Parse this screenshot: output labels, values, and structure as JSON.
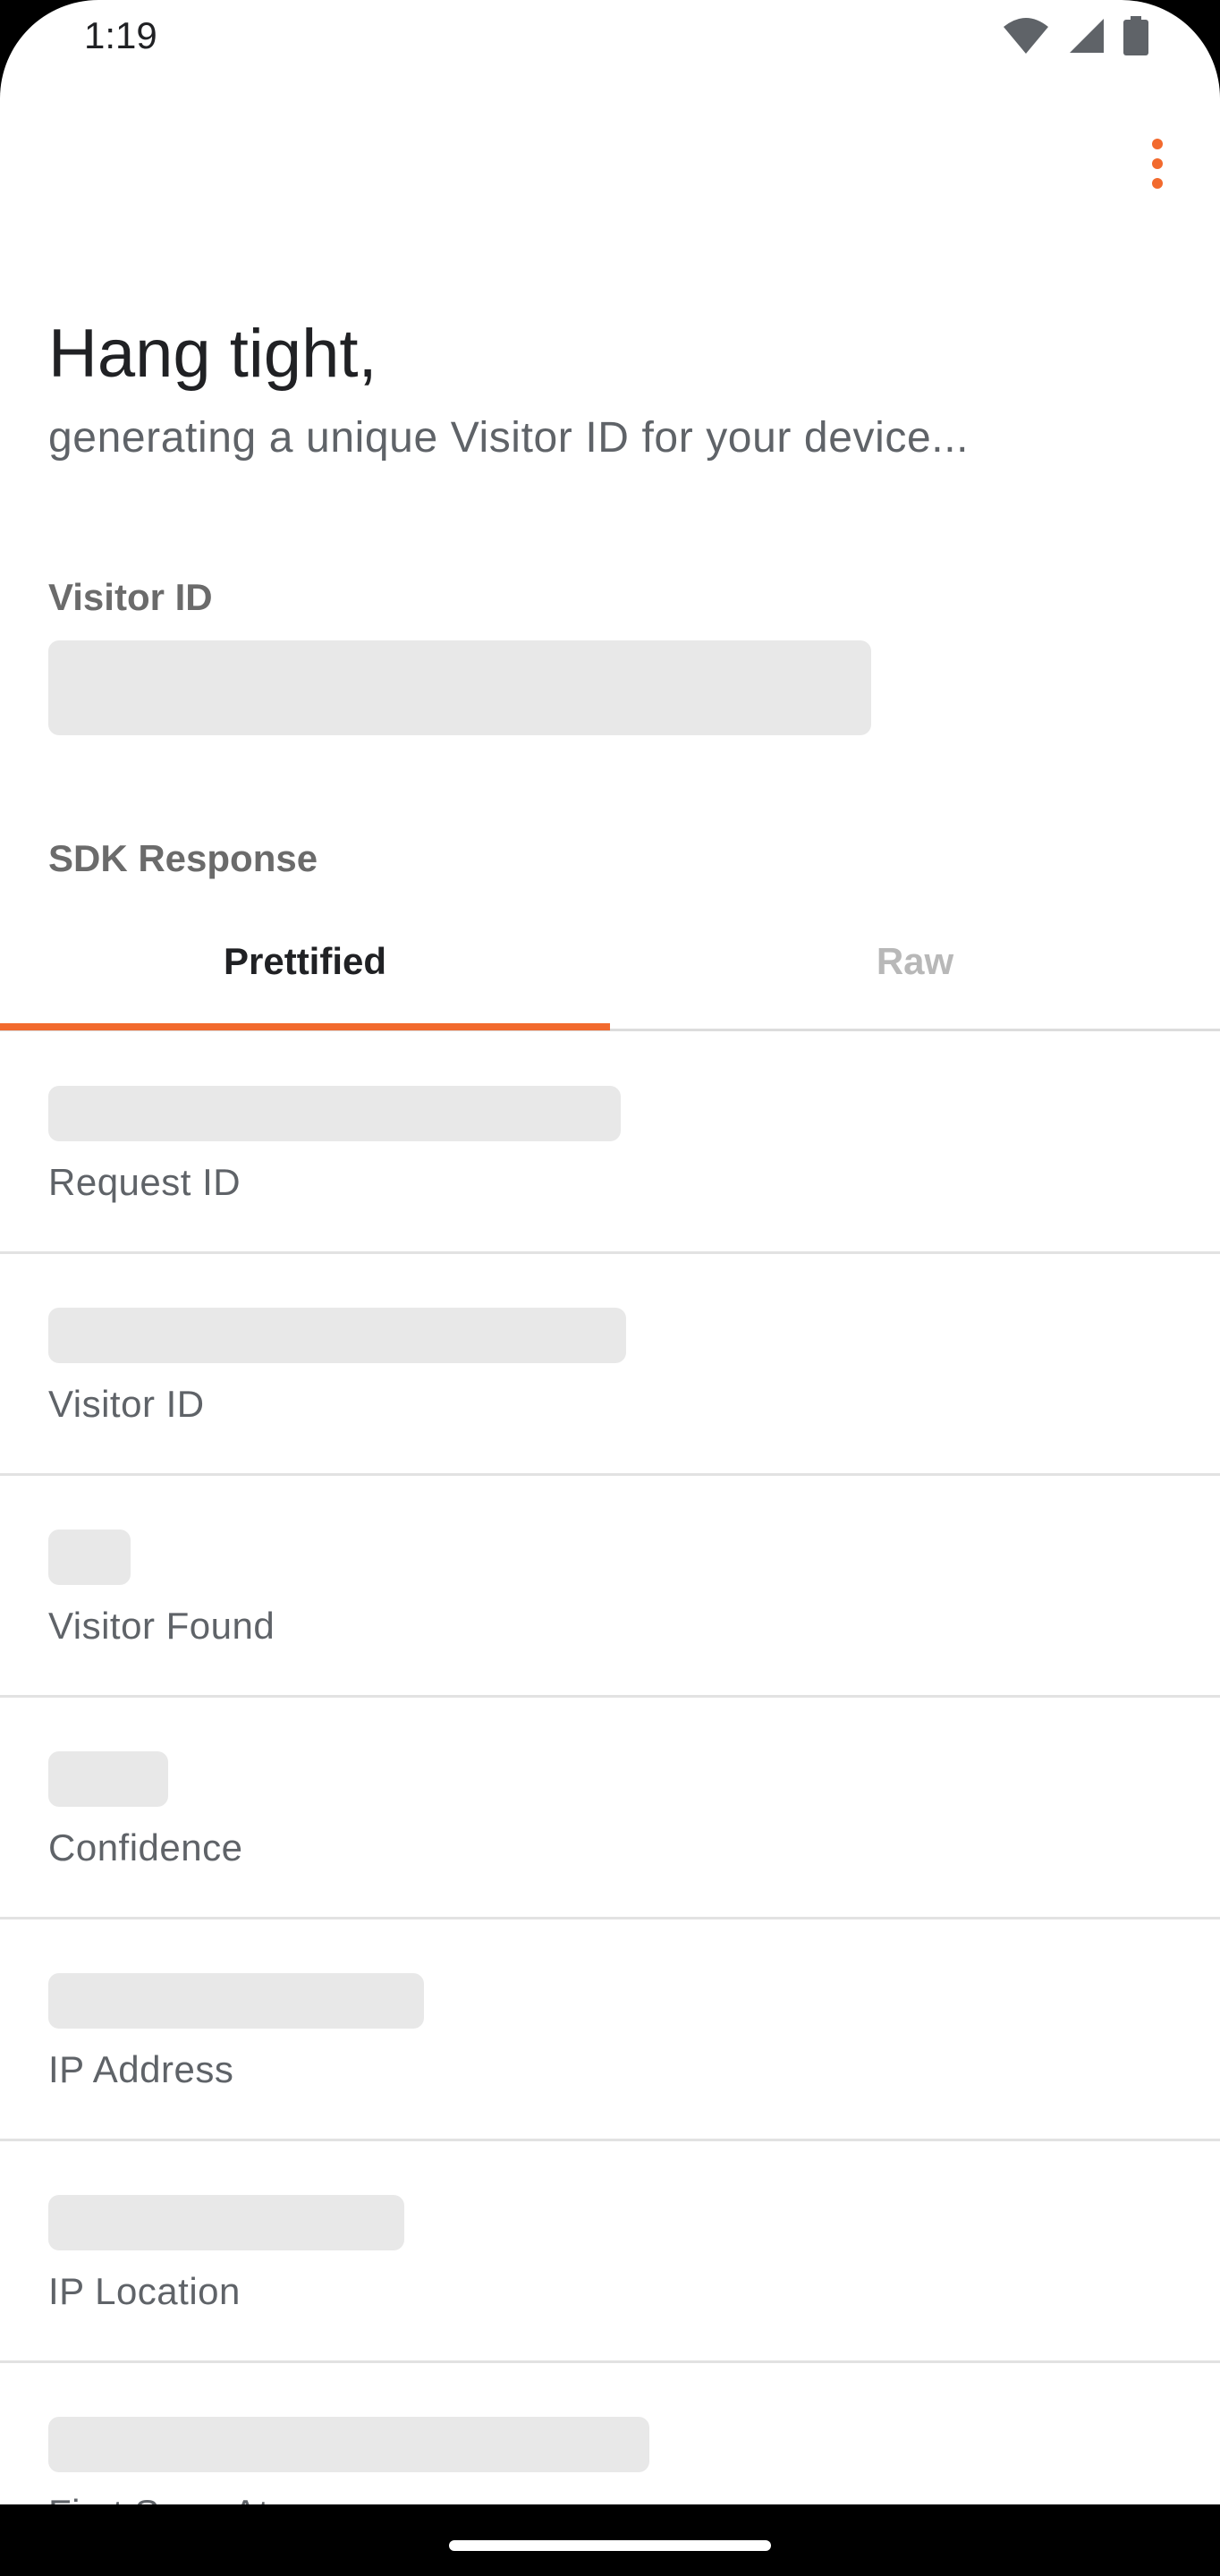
{
  "status_bar": {
    "time": "1:19",
    "icons": [
      "wifi-icon",
      "signal-icon",
      "battery-icon"
    ]
  },
  "toolbar": {
    "menu_icon": "more-vert-icon",
    "accent_color": "#f26a2e"
  },
  "header": {
    "title": "Hang tight,",
    "subtitle": "generating a unique Visitor ID for your device..."
  },
  "visitor_section": {
    "label": "Visitor ID",
    "value_loading": true
  },
  "sdk_section": {
    "label": "SDK Response",
    "tabs": [
      {
        "label": "Prettified",
        "selected": true
      },
      {
        "label": "Raw",
        "selected": false
      }
    ]
  },
  "fields": [
    {
      "label": "Request ID",
      "loading_fraction": 0.47
    },
    {
      "label": "Visitor ID",
      "loading_fraction": 0.48
    },
    {
      "label": "Visitor Found",
      "loading_fraction": 0.07
    },
    {
      "label": "Confidence",
      "loading_fraction": 0.1
    },
    {
      "label": "IP Address",
      "loading_fraction": 0.31
    },
    {
      "label": "IP Location",
      "loading_fraction": 0.29
    },
    {
      "label": "First Seen At",
      "loading_fraction": 0.49
    }
  ]
}
